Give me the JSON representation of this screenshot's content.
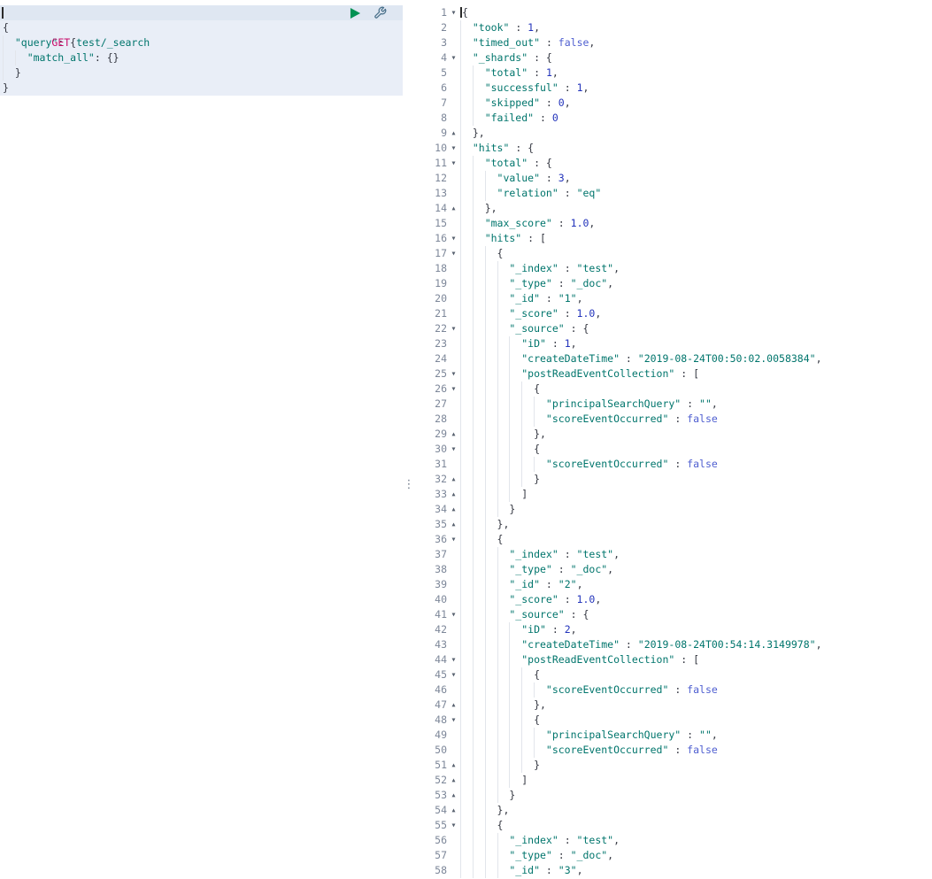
{
  "colors": {
    "method": "#c80a68",
    "url": "#00756c",
    "key": "#00756c",
    "string": "#00756c",
    "number": "#2233bb",
    "boolean": "#4f5fd0",
    "punct": "#343741",
    "lineNumber": "#7d8799",
    "fold": "#57606e",
    "guide": "#e2e5eb",
    "requestBg": "#e9eef7",
    "requestActiveBg": "#dfe7f2",
    "play": "#009153",
    "wrench": "#49708a"
  },
  "icons": {
    "send": "play-icon",
    "options": "wrench-icon",
    "fold_open": "▾",
    "fold_close": "▴",
    "grip": "⋮"
  },
  "request": {
    "method": "GET",
    "url": "test/_search",
    "lines": [
      {
        "ind": 0,
        "seg": [
          [
            "p",
            "{"
          ]
        ]
      },
      {
        "ind": 1,
        "seg": [
          [
            "k",
            "\"query\""
          ],
          [
            "p",
            ": {"
          ]
        ]
      },
      {
        "ind": 2,
        "seg": [
          [
            "k",
            "\"match_all\""
          ],
          [
            "p",
            ": {}"
          ]
        ]
      },
      {
        "ind": 1,
        "seg": [
          [
            "p",
            "}"
          ]
        ]
      },
      {
        "ind": 0,
        "seg": [
          [
            "p",
            "}"
          ]
        ]
      }
    ]
  },
  "response": {
    "lines": [
      {
        "n": 1,
        "f": "d",
        "ind": 0,
        "cur": true,
        "seg": [
          [
            "p",
            "{"
          ]
        ]
      },
      {
        "n": 2,
        "ind": 1,
        "seg": [
          [
            "k",
            "\"took\""
          ],
          [
            "p",
            " : "
          ],
          [
            "n",
            "1"
          ],
          [
            "p",
            ","
          ]
        ]
      },
      {
        "n": 3,
        "ind": 1,
        "seg": [
          [
            "k",
            "\"timed_out\""
          ],
          [
            "p",
            " : "
          ],
          [
            "b",
            "false"
          ],
          [
            "p",
            ","
          ]
        ]
      },
      {
        "n": 4,
        "f": "d",
        "ind": 1,
        "seg": [
          [
            "k",
            "\"_shards\""
          ],
          [
            "p",
            " : {"
          ]
        ]
      },
      {
        "n": 5,
        "ind": 2,
        "seg": [
          [
            "k",
            "\"total\""
          ],
          [
            "p",
            " : "
          ],
          [
            "n",
            "1"
          ],
          [
            "p",
            ","
          ]
        ]
      },
      {
        "n": 6,
        "ind": 2,
        "seg": [
          [
            "k",
            "\"successful\""
          ],
          [
            "p",
            " : "
          ],
          [
            "n",
            "1"
          ],
          [
            "p",
            ","
          ]
        ]
      },
      {
        "n": 7,
        "ind": 2,
        "seg": [
          [
            "k",
            "\"skipped\""
          ],
          [
            "p",
            " : "
          ],
          [
            "n",
            "0"
          ],
          [
            "p",
            ","
          ]
        ]
      },
      {
        "n": 8,
        "ind": 2,
        "seg": [
          [
            "k",
            "\"failed\""
          ],
          [
            "p",
            " : "
          ],
          [
            "n",
            "0"
          ]
        ]
      },
      {
        "n": 9,
        "f": "u",
        "ind": 1,
        "seg": [
          [
            "p",
            "},"
          ]
        ]
      },
      {
        "n": 10,
        "f": "d",
        "ind": 1,
        "seg": [
          [
            "k",
            "\"hits\""
          ],
          [
            "p",
            " : {"
          ]
        ]
      },
      {
        "n": 11,
        "f": "d",
        "ind": 2,
        "seg": [
          [
            "k",
            "\"total\""
          ],
          [
            "p",
            " : {"
          ]
        ]
      },
      {
        "n": 12,
        "ind": 3,
        "seg": [
          [
            "k",
            "\"value\""
          ],
          [
            "p",
            " : "
          ],
          [
            "n",
            "3"
          ],
          [
            "p",
            ","
          ]
        ]
      },
      {
        "n": 13,
        "ind": 3,
        "seg": [
          [
            "k",
            "\"relation\""
          ],
          [
            "p",
            " : "
          ],
          [
            "s",
            "\"eq\""
          ]
        ]
      },
      {
        "n": 14,
        "f": "u",
        "ind": 2,
        "seg": [
          [
            "p",
            "},"
          ]
        ]
      },
      {
        "n": 15,
        "ind": 2,
        "seg": [
          [
            "k",
            "\"max_score\""
          ],
          [
            "p",
            " : "
          ],
          [
            "n",
            "1.0"
          ],
          [
            "p",
            ","
          ]
        ]
      },
      {
        "n": 16,
        "f": "d",
        "ind": 2,
        "seg": [
          [
            "k",
            "\"hits\""
          ],
          [
            "p",
            " : ["
          ]
        ]
      },
      {
        "n": 17,
        "f": "d",
        "ind": 3,
        "seg": [
          [
            "p",
            "{"
          ]
        ]
      },
      {
        "n": 18,
        "ind": 4,
        "seg": [
          [
            "k",
            "\"_index\""
          ],
          [
            "p",
            " : "
          ],
          [
            "s",
            "\"test\""
          ],
          [
            "p",
            ","
          ]
        ]
      },
      {
        "n": 19,
        "ind": 4,
        "seg": [
          [
            "k",
            "\"_type\""
          ],
          [
            "p",
            " : "
          ],
          [
            "s",
            "\"_doc\""
          ],
          [
            "p",
            ","
          ]
        ]
      },
      {
        "n": 20,
        "ind": 4,
        "seg": [
          [
            "k",
            "\"_id\""
          ],
          [
            "p",
            " : "
          ],
          [
            "s",
            "\"1\""
          ],
          [
            "p",
            ","
          ]
        ]
      },
      {
        "n": 21,
        "ind": 4,
        "seg": [
          [
            "k",
            "\"_score\""
          ],
          [
            "p",
            " : "
          ],
          [
            "n",
            "1.0"
          ],
          [
            "p",
            ","
          ]
        ]
      },
      {
        "n": 22,
        "f": "d",
        "ind": 4,
        "seg": [
          [
            "k",
            "\"_source\""
          ],
          [
            "p",
            " : {"
          ]
        ]
      },
      {
        "n": 23,
        "ind": 5,
        "seg": [
          [
            "k",
            "\"iD\""
          ],
          [
            "p",
            " : "
          ],
          [
            "n",
            "1"
          ],
          [
            "p",
            ","
          ]
        ]
      },
      {
        "n": 24,
        "ind": 5,
        "seg": [
          [
            "k",
            "\"createDateTime\""
          ],
          [
            "p",
            " : "
          ],
          [
            "s",
            "\"2019-08-24T00:50:02.0058384\""
          ],
          [
            "p",
            ","
          ]
        ]
      },
      {
        "n": 25,
        "f": "d",
        "ind": 5,
        "seg": [
          [
            "k",
            "\"postReadEventCollection\""
          ],
          [
            "p",
            " : ["
          ]
        ]
      },
      {
        "n": 26,
        "f": "d",
        "ind": 6,
        "seg": [
          [
            "p",
            "{"
          ]
        ]
      },
      {
        "n": 27,
        "ind": 7,
        "seg": [
          [
            "k",
            "\"principalSearchQuery\""
          ],
          [
            "p",
            " : "
          ],
          [
            "s",
            "\"\""
          ],
          [
            "p",
            ","
          ]
        ]
      },
      {
        "n": 28,
        "ind": 7,
        "seg": [
          [
            "k",
            "\"scoreEventOccurred\""
          ],
          [
            "p",
            " : "
          ],
          [
            "b",
            "false"
          ]
        ]
      },
      {
        "n": 29,
        "f": "u",
        "ind": 6,
        "seg": [
          [
            "p",
            "},"
          ]
        ]
      },
      {
        "n": 30,
        "f": "d",
        "ind": 6,
        "seg": [
          [
            "p",
            "{"
          ]
        ]
      },
      {
        "n": 31,
        "ind": 7,
        "seg": [
          [
            "k",
            "\"scoreEventOccurred\""
          ],
          [
            "p",
            " : "
          ],
          [
            "b",
            "false"
          ]
        ]
      },
      {
        "n": 32,
        "f": "u",
        "ind": 6,
        "seg": [
          [
            "p",
            "}"
          ]
        ]
      },
      {
        "n": 33,
        "f": "u",
        "ind": 5,
        "seg": [
          [
            "p",
            "]"
          ]
        ]
      },
      {
        "n": 34,
        "f": "u",
        "ind": 4,
        "seg": [
          [
            "p",
            "}"
          ]
        ]
      },
      {
        "n": 35,
        "f": "u",
        "ind": 3,
        "seg": [
          [
            "p",
            "},"
          ]
        ]
      },
      {
        "n": 36,
        "f": "d",
        "ind": 3,
        "seg": [
          [
            "p",
            "{"
          ]
        ]
      },
      {
        "n": 37,
        "ind": 4,
        "seg": [
          [
            "k",
            "\"_index\""
          ],
          [
            "p",
            " : "
          ],
          [
            "s",
            "\"test\""
          ],
          [
            "p",
            ","
          ]
        ]
      },
      {
        "n": 38,
        "ind": 4,
        "seg": [
          [
            "k",
            "\"_type\""
          ],
          [
            "p",
            " : "
          ],
          [
            "s",
            "\"_doc\""
          ],
          [
            "p",
            ","
          ]
        ]
      },
      {
        "n": 39,
        "ind": 4,
        "seg": [
          [
            "k",
            "\"_id\""
          ],
          [
            "p",
            " : "
          ],
          [
            "s",
            "\"2\""
          ],
          [
            "p",
            ","
          ]
        ]
      },
      {
        "n": 40,
        "ind": 4,
        "seg": [
          [
            "k",
            "\"_score\""
          ],
          [
            "p",
            " : "
          ],
          [
            "n",
            "1.0"
          ],
          [
            "p",
            ","
          ]
        ]
      },
      {
        "n": 41,
        "f": "d",
        "ind": 4,
        "seg": [
          [
            "k",
            "\"_source\""
          ],
          [
            "p",
            " : {"
          ]
        ]
      },
      {
        "n": 42,
        "ind": 5,
        "seg": [
          [
            "k",
            "\"iD\""
          ],
          [
            "p",
            " : "
          ],
          [
            "n",
            "2"
          ],
          [
            "p",
            ","
          ]
        ]
      },
      {
        "n": 43,
        "ind": 5,
        "seg": [
          [
            "k",
            "\"createDateTime\""
          ],
          [
            "p",
            " : "
          ],
          [
            "s",
            "\"2019-08-24T00:54:14.3149978\""
          ],
          [
            "p",
            ","
          ]
        ]
      },
      {
        "n": 44,
        "f": "d",
        "ind": 5,
        "seg": [
          [
            "k",
            "\"postReadEventCollection\""
          ],
          [
            "p",
            " : ["
          ]
        ]
      },
      {
        "n": 45,
        "f": "d",
        "ind": 6,
        "seg": [
          [
            "p",
            "{"
          ]
        ]
      },
      {
        "n": 46,
        "ind": 7,
        "seg": [
          [
            "k",
            "\"scoreEventOccurred\""
          ],
          [
            "p",
            " : "
          ],
          [
            "b",
            "false"
          ]
        ]
      },
      {
        "n": 47,
        "f": "u",
        "ind": 6,
        "seg": [
          [
            "p",
            "},"
          ]
        ]
      },
      {
        "n": 48,
        "f": "d",
        "ind": 6,
        "seg": [
          [
            "p",
            "{"
          ]
        ]
      },
      {
        "n": 49,
        "ind": 7,
        "seg": [
          [
            "k",
            "\"principalSearchQuery\""
          ],
          [
            "p",
            " : "
          ],
          [
            "s",
            "\"\""
          ],
          [
            "p",
            ","
          ]
        ]
      },
      {
        "n": 50,
        "ind": 7,
        "seg": [
          [
            "k",
            "\"scoreEventOccurred\""
          ],
          [
            "p",
            " : "
          ],
          [
            "b",
            "false"
          ]
        ]
      },
      {
        "n": 51,
        "f": "u",
        "ind": 6,
        "seg": [
          [
            "p",
            "}"
          ]
        ]
      },
      {
        "n": 52,
        "f": "u",
        "ind": 5,
        "seg": [
          [
            "p",
            "]"
          ]
        ]
      },
      {
        "n": 53,
        "f": "u",
        "ind": 4,
        "seg": [
          [
            "p",
            "}"
          ]
        ]
      },
      {
        "n": 54,
        "f": "u",
        "ind": 3,
        "seg": [
          [
            "p",
            "},"
          ]
        ]
      },
      {
        "n": 55,
        "f": "d",
        "ind": 3,
        "seg": [
          [
            "p",
            "{"
          ]
        ]
      },
      {
        "n": 56,
        "ind": 4,
        "seg": [
          [
            "k",
            "\"_index\""
          ],
          [
            "p",
            " : "
          ],
          [
            "s",
            "\"test\""
          ],
          [
            "p",
            ","
          ]
        ]
      },
      {
        "n": 57,
        "ind": 4,
        "seg": [
          [
            "k",
            "\"_type\""
          ],
          [
            "p",
            " : "
          ],
          [
            "s",
            "\"_doc\""
          ],
          [
            "p",
            ","
          ]
        ]
      },
      {
        "n": 58,
        "ind": 4,
        "seg": [
          [
            "k",
            "\"_id\""
          ],
          [
            "p",
            " : "
          ],
          [
            "s",
            "\"3\""
          ],
          [
            "p",
            ","
          ]
        ]
      }
    ]
  }
}
